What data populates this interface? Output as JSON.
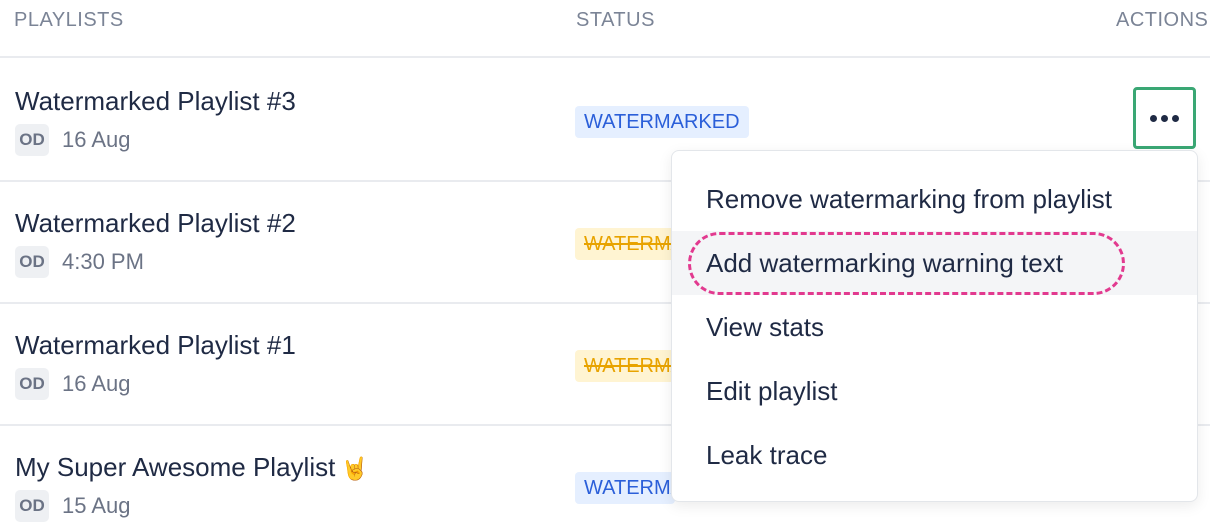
{
  "header": {
    "playlists": "PLAYLISTS",
    "status": "STATUS",
    "actions": "ACTIONS"
  },
  "rows": [
    {
      "title": "Watermarked Playlist #3",
      "initials": "OD",
      "date": "16 Aug",
      "status": "WATERMARKED",
      "status_color": "#2b5fd9"
    },
    {
      "title": "Watermarked Playlist #2",
      "initials": "OD",
      "date": "4:30 PM",
      "status": "WATERMARKED",
      "status_color": "#e8a300"
    },
    {
      "title": "Watermarked Playlist #1",
      "initials": "OD",
      "date": "16 Aug",
      "status": "WATERMARKED",
      "status_color": "#e8a300"
    },
    {
      "title": "My Super Awesome Playlist",
      "emoji": "🤘",
      "initials": "OD",
      "date": "15 Aug",
      "status": "WATERMARKED",
      "status_color": "#2b5fd9"
    }
  ],
  "actions_button": {
    "icon": "more-horizontal-icon",
    "accent": "#3aa774"
  },
  "menu": {
    "items": [
      "Remove watermarking from playlist",
      "Add watermarking warning text",
      "View stats",
      "Edit playlist",
      "Leak trace"
    ],
    "highlight_color": "#e23a8f"
  }
}
